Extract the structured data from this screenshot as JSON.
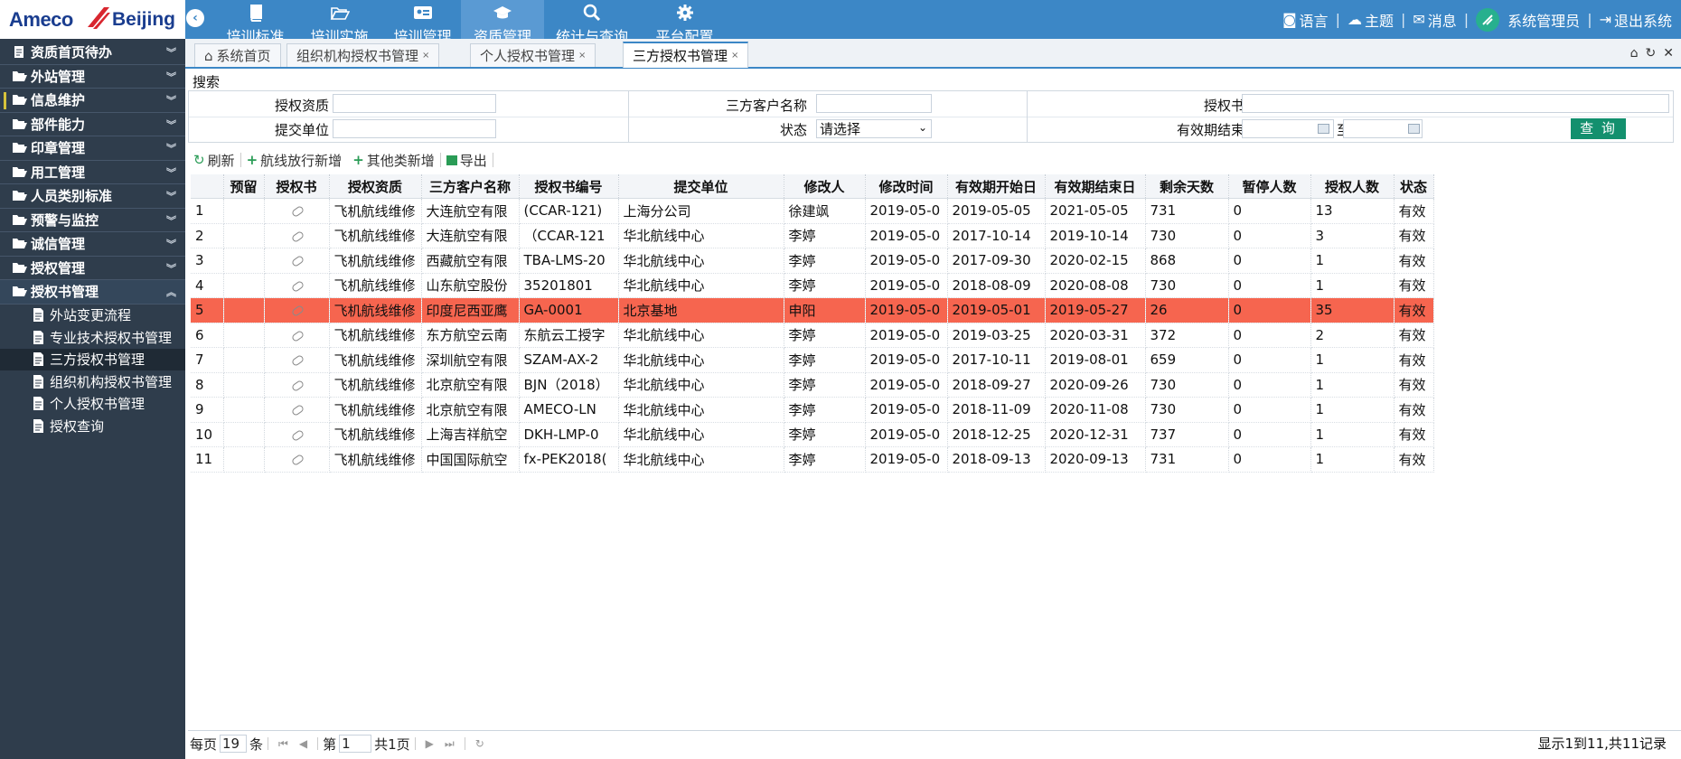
{
  "brand": {
    "name_left": "Ameco",
    "name_right": "Beijing"
  },
  "topnav": [
    {
      "label": "培训标准",
      "icon": "book-icon"
    },
    {
      "label": "培训实施",
      "icon": "folder-open-icon"
    },
    {
      "label": "培训管理",
      "icon": "id-card-icon"
    },
    {
      "label": "资质管理",
      "icon": "graduation-cap-icon"
    },
    {
      "label": "统计与查询",
      "icon": "search-icon"
    },
    {
      "label": "平台配置",
      "icon": "gear-icon"
    }
  ],
  "user_bar": {
    "language": "语言",
    "theme": "主题",
    "messages": "消息",
    "user": "系统管理员",
    "logout": "退出系统"
  },
  "sidebar": {
    "items": [
      {
        "label": "资质首页待办"
      },
      {
        "label": "外站管理"
      },
      {
        "label": "信息维护"
      },
      {
        "label": "部件能力"
      },
      {
        "label": "印章管理"
      },
      {
        "label": "用工管理"
      },
      {
        "label": "人员类别标准"
      },
      {
        "label": "预警与监控"
      },
      {
        "label": "诚信管理"
      },
      {
        "label": "授权管理"
      },
      {
        "label": "授权书管理"
      }
    ],
    "subitems": [
      {
        "label": "外站变更流程"
      },
      {
        "label": "专业技术授权书管理"
      },
      {
        "label": "三方授权书管理"
      },
      {
        "label": "组织机构授权书管理"
      },
      {
        "label": "个人授权书管理"
      },
      {
        "label": "授权查询"
      }
    ]
  },
  "tabs": [
    {
      "label": "系统首页"
    },
    {
      "label": "组织机构授权书管理"
    },
    {
      "label": "个人授权书管理"
    },
    {
      "label": "三方授权书管理"
    }
  ],
  "search": {
    "title": "搜索",
    "auth_qual_label": "授权资质",
    "client_label": "三方客户名称",
    "auth_no_label": "授权书编号",
    "submit_unit_label": "提交单位",
    "status_label": "状态",
    "status_value": "请选择",
    "valid_end_label": "有效期结束日期",
    "to_label": "至",
    "query_button": "查 询"
  },
  "toolbar": {
    "refresh": "刷新",
    "add_flight": "航线放行新增",
    "add_other": "其他类新增",
    "export": "导出"
  },
  "table": {
    "columns": [
      "",
      "预留",
      "授权书",
      "授权资质",
      "三方客户名称",
      "授权书编号",
      "提交单位",
      "修改人",
      "修改时间",
      "有效期开始日",
      "有效期结束日",
      "剩余天数",
      "暂停人数",
      "授权人数",
      "状态"
    ],
    "rows": [
      [
        "1",
        "",
        "",
        "飞机航线维修",
        "大连航空有限",
        "(CCAR-121)",
        "上海分公司",
        "徐建飒",
        "2019-05-0",
        "2019-05-05",
        "2021-05-05",
        "731",
        "0",
        "13",
        "有效"
      ],
      [
        "2",
        "",
        "",
        "飞机航线维修",
        "大连航空有限",
        "（CCAR-121",
        "华北航线中心",
        "李婷",
        "2019-05-0",
        "2017-10-14",
        "2019-10-14",
        "730",
        "0",
        "3",
        "有效"
      ],
      [
        "3",
        "",
        "",
        "飞机航线维修",
        "西藏航空有限",
        "TBA-LMS-20",
        "华北航线中心",
        "李婷",
        "2019-05-0",
        "2017-09-30",
        "2020-02-15",
        "868",
        "0",
        "1",
        "有效"
      ],
      [
        "4",
        "",
        "",
        "飞机航线维修",
        "山东航空股份",
        "35201801",
        "华北航线中心",
        "李婷",
        "2019-05-0",
        "2018-08-09",
        "2020-08-08",
        "730",
        "0",
        "1",
        "有效"
      ],
      [
        "5",
        "",
        "",
        "飞机航线维修",
        "印度尼西亚鹰",
        "GA-0001",
        "北京基地",
        "申阳",
        "2019-05-0",
        "2019-05-01",
        "2019-05-27",
        "26",
        "0",
        "35",
        "有效"
      ],
      [
        "6",
        "",
        "",
        "飞机航线维修",
        "东方航空云南",
        "东航云工授字",
        "华北航线中心",
        "李婷",
        "2019-05-0",
        "2019-03-25",
        "2020-03-31",
        "372",
        "0",
        "2",
        "有效"
      ],
      [
        "7",
        "",
        "",
        "飞机航线维修",
        "深圳航空有限",
        "SZAM-AX-2",
        "华北航线中心",
        "李婷",
        "2019-05-0",
        "2017-10-11",
        "2019-08-01",
        "659",
        "0",
        "1",
        "有效"
      ],
      [
        "8",
        "",
        "",
        "飞机航线维修",
        "北京航空有限",
        "BJN（2018）",
        "华北航线中心",
        "李婷",
        "2019-05-0",
        "2018-09-27",
        "2020-09-26",
        "730",
        "0",
        "1",
        "有效"
      ],
      [
        "9",
        "",
        "",
        "飞机航线维修",
        "北京航空有限",
        "AMECO-LN",
        "华北航线中心",
        "李婷",
        "2019-05-0",
        "2018-11-09",
        "2020-11-08",
        "730",
        "0",
        "1",
        "有效"
      ],
      [
        "10",
        "",
        "",
        "飞机航线维修",
        "上海吉祥航空",
        "DKH-LMP-0",
        "华北航线中心",
        "李婷",
        "2019-05-0",
        "2018-12-25",
        "2020-12-31",
        "737",
        "0",
        "1",
        "有效"
      ],
      [
        "11",
        "",
        "",
        "飞机航线维修",
        "中国国际航空",
        "fx-PEK2018(",
        "华北航线中心",
        "李婷",
        "2019-05-0",
        "2018-09-13",
        "2020-09-13",
        "731",
        "0",
        "1",
        "有效"
      ]
    ],
    "highlight_row": 5,
    "highlight_color": "#f6654f"
  },
  "pager": {
    "per_page_label": "每页",
    "per_page_value": "19",
    "per_page_unit": "条",
    "page_prefix": "第",
    "page_value": "1",
    "page_total": "共1页",
    "info": "显示1到11,共11记录"
  },
  "colors": {
    "topbar": "#3c87c6",
    "sidebar": "#2f3d4c",
    "query_button": "#13906e"
  }
}
